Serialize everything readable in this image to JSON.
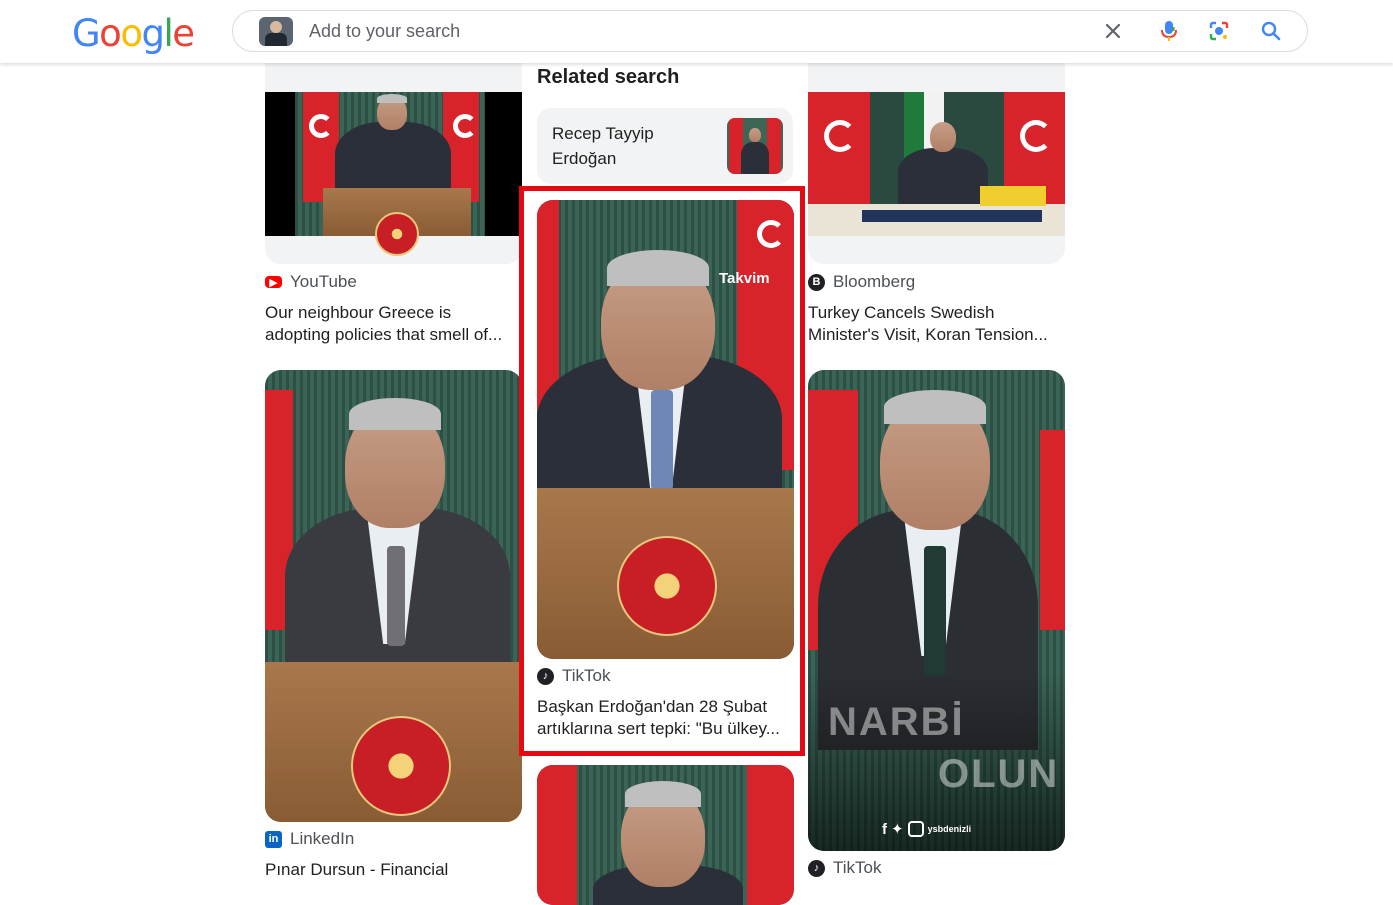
{
  "brand": {
    "logo_letters": [
      "G",
      "o",
      "o",
      "g",
      "l",
      "e"
    ],
    "logo_colors": [
      "#4285f4",
      "#ea4335",
      "#fbbc05",
      "#4285f4",
      "#34a853",
      "#ea4335"
    ]
  },
  "search": {
    "placeholder": "Add to your search",
    "clear_icon": "close-icon",
    "voice_icon": "mic-icon",
    "lens_icon": "camera-lens-icon",
    "search_icon": "search-icon"
  },
  "related": {
    "heading": "Related search",
    "chip_line1": "Recep Tayyip",
    "chip_line2": "Erdoğan"
  },
  "results": [
    {
      "source": "YouTube",
      "source_color": "#ff0000",
      "title_line1": "Our neighbour Greece is",
      "title_line2": "adopting policies that smell of..."
    },
    {
      "source": "Bloomberg",
      "source_color": "#202124",
      "title_line1": "Turkey Cancels Swedish",
      "title_line2": "Minister's Visit, Koran Tension..."
    },
    {
      "source": "TikTok",
      "source_color": "#202124",
      "title_line1": "Başkan Erdoğan'dan 28 Şubat",
      "title_line2": "artıklarına sert tepki: \"Bu ülkey...",
      "watermark": "Takvim",
      "selected": true
    },
    {
      "source": "LinkedIn",
      "source_color": "#0a66c2",
      "title_line1": "Pınar Dursun - Financial"
    },
    {
      "source": "TikTok",
      "source_color": "#202124",
      "overlay_text_1": "NARBİ",
      "overlay_text_2": "OLUN",
      "handle": "ysbdenizli"
    }
  ]
}
